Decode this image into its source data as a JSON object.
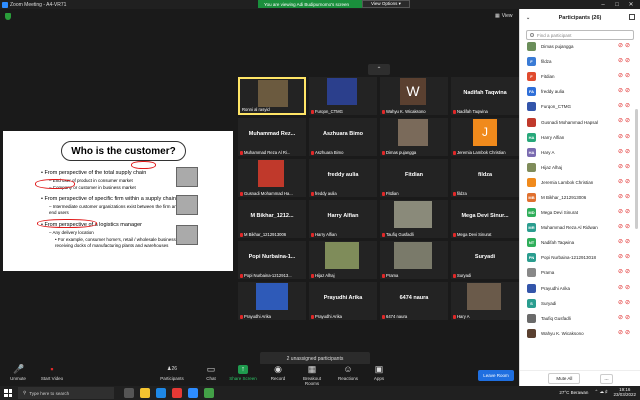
{
  "window": {
    "title": "Zoom Meeting - A4-VR71"
  },
  "banner": {
    "text": "You are viewing Adi Budipurnomo's screen",
    "options_label": "View Options ▾"
  },
  "view_button": {
    "label": "View"
  },
  "slide": {
    "title": "Who is the customer?",
    "lines": [
      "• From perspective of the total supply chain",
      "– End user of product in consumer market",
      "– Company or customer in business market",
      "• From perspective of specific firm within a supply chain",
      "– Intermediate customer organizations exist between the firm and",
      "   end users",
      "• From perspective of a logistics manager",
      "– Any delivery location",
      "• For example, consumer home's, retail / wholesale businesses,",
      "   receiving docks of manufacturing plants and warehouses"
    ]
  },
  "tiles": [
    {
      "name": "",
      "label": "Ronni al rasyid",
      "active": true,
      "img": "person"
    },
    {
      "name": "",
      "label": "Furqon_CTMG",
      "img": "blue"
    },
    {
      "name": "",
      "label": "Wahyu K. Wicaksono",
      "img": "W"
    },
    {
      "name": "Nadifah Taqwina",
      "label": "Nadifah Taqwina"
    },
    {
      "name": "Muhammad Rez...",
      "label": "Muhammad Reza Al Ri..."
    },
    {
      "name": "Aszhuara Bimo",
      "label": "Aszhuara Bimo"
    },
    {
      "name": "",
      "label": "Dimas pujangga",
      "img": "photo"
    },
    {
      "name": "",
      "label": "Jeremia Lambok Christian",
      "img": "J"
    },
    {
      "name": "",
      "label": "Gusnadi Mohammad Ha...",
      "img": "red"
    },
    {
      "name": "freddy aulia",
      "label": "freddy aulia"
    },
    {
      "name": "Fitdian",
      "label": "Fitdian"
    },
    {
      "name": "fildza",
      "label": "fildza"
    },
    {
      "name": "M Bikhar_1212...",
      "label": "M Bikhar_1212913006"
    },
    {
      "name": "Harry Alfian",
      "label": "Harry Alfian"
    },
    {
      "name": "",
      "label": "Taufiq Gusfadli",
      "img": "photo"
    },
    {
      "name": "Mega Devi Sinur...",
      "label": "Mega Devi Sinurat"
    },
    {
      "name": "Popi Nurbaina-1...",
      "label": "Popi Nurbaina-1212913..."
    },
    {
      "name": "",
      "label": "Hijaz Alhaj",
      "img": "photo2"
    },
    {
      "name": "",
      "label": "Prama",
      "img": "photo"
    },
    {
      "name": "Suryadi",
      "label": "Suryadi"
    },
    {
      "name": "",
      "label": "Prayudhi Arika",
      "img": "screen"
    },
    {
      "name": "Prayudhi Arika",
      "label": "Prayudhi Arika"
    },
    {
      "name": "6474 naura",
      "label": "6474 naura"
    },
    {
      "name": "",
      "label": "Hary A",
      "img": "photo2"
    }
  ],
  "unassigned": {
    "text": "2 unassigned participants"
  },
  "toolbar": {
    "unmute": "Unmute",
    "start_video": "Start Video",
    "participants": "Participants",
    "participants_count": "26",
    "chat": "Chat",
    "share": "Share Screen",
    "record": "Record",
    "breakout": "Breakout Rooms",
    "reactions": "Reactions",
    "apps": "Apps",
    "leave": "Leave Room"
  },
  "panel": {
    "title": "Participants (26)",
    "search_placeholder": "Find a participant",
    "mute_all": "Mute All",
    "more": "...",
    "participants": [
      {
        "initials": "",
        "name": "Dimas pujangga",
        "color": "#6b8e5a",
        "photo": true
      },
      {
        "initials": "F",
        "name": "fildza",
        "color": "#3a7bd5"
      },
      {
        "initials": "F",
        "name": "Fitdian",
        "color": "#e04b2e"
      },
      {
        "initials": "FA",
        "name": "freddy aulia",
        "color": "#2f6fd8"
      },
      {
        "initials": "",
        "name": "Furqon_CTMG",
        "color": "#3355aa",
        "photo": true
      },
      {
        "initials": "",
        "name": "Gusnadi Mohammad Hapsal",
        "color": "#c0392b",
        "photo": true
      },
      {
        "initials": "HA",
        "name": "Harry Alfian",
        "color": "#27a87a"
      },
      {
        "initials": "HA",
        "name": "Hary A",
        "color": "#7a6bb0"
      },
      {
        "initials": "",
        "name": "Hijaz Alhaj",
        "color": "#7f8c5a",
        "photo": true
      },
      {
        "initials": "",
        "name": "Jeremia Lambok Christian",
        "color": "#f08a1c",
        "photo": true
      },
      {
        "initials": "MB",
        "name": "M Bikhar_1212913006",
        "color": "#e0702e"
      },
      {
        "initials": "MD",
        "name": "Mega Devi Sinurat",
        "color": "#2fae5a"
      },
      {
        "initials": "MR",
        "name": "Muhammad Reza Al Ridwan",
        "color": "#2a9d8f"
      },
      {
        "initials": "NT",
        "name": "Nadifah Taqwina",
        "color": "#2fae5a"
      },
      {
        "initials": "PN",
        "name": "Popi Nurbaina-1212913018",
        "color": "#2a9d8f"
      },
      {
        "initials": "",
        "name": "Prama",
        "color": "#888888",
        "photo": true
      },
      {
        "initials": "",
        "name": "Prayudhi Arika",
        "color": "#3355aa",
        "photo": true
      },
      {
        "initials": "S",
        "name": "Suryadi",
        "color": "#2a9d8f"
      },
      {
        "initials": "",
        "name": "Taufiq Gusfadli",
        "color": "#6a6a6a",
        "photo": true
      },
      {
        "initials": "",
        "name": "Wahyu K. Wicaksono",
        "color": "#5a4030",
        "photo": true
      }
    ]
  },
  "taskbar": {
    "search_placeholder": "Type here to search",
    "weather": "27°C Berawan",
    "time": "19:16",
    "date": "23/03/2022"
  }
}
